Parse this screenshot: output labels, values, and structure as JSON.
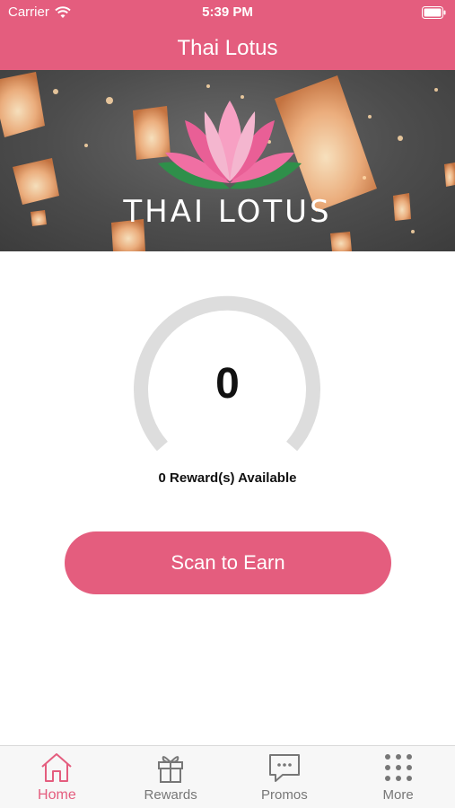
{
  "status_bar": {
    "carrier": "Carrier",
    "time": "5:39 PM",
    "icons": [
      "wifi-icon",
      "battery-icon"
    ]
  },
  "nav": {
    "title": "Thai Lotus"
  },
  "banner": {
    "brand_text": "THAI LOTUS",
    "logo": "lotus-flower-logo"
  },
  "rewards": {
    "points": "0",
    "available_text": "0 Reward(s) Available",
    "progress": 0
  },
  "actions": {
    "scan_label": "Scan to Earn"
  },
  "tabbar": {
    "items": [
      {
        "label": "Home",
        "icon": "home-icon",
        "active": true
      },
      {
        "label": "Rewards",
        "icon": "gift-icon",
        "active": false
      },
      {
        "label": "Promos",
        "icon": "chat-bubble-icon",
        "active": false
      },
      {
        "label": "More",
        "icon": "grid-dots-icon",
        "active": false
      }
    ]
  },
  "colors": {
    "brand": "#e45d7e",
    "gauge_track": "#dddddd",
    "tab_inactive": "#777777"
  }
}
